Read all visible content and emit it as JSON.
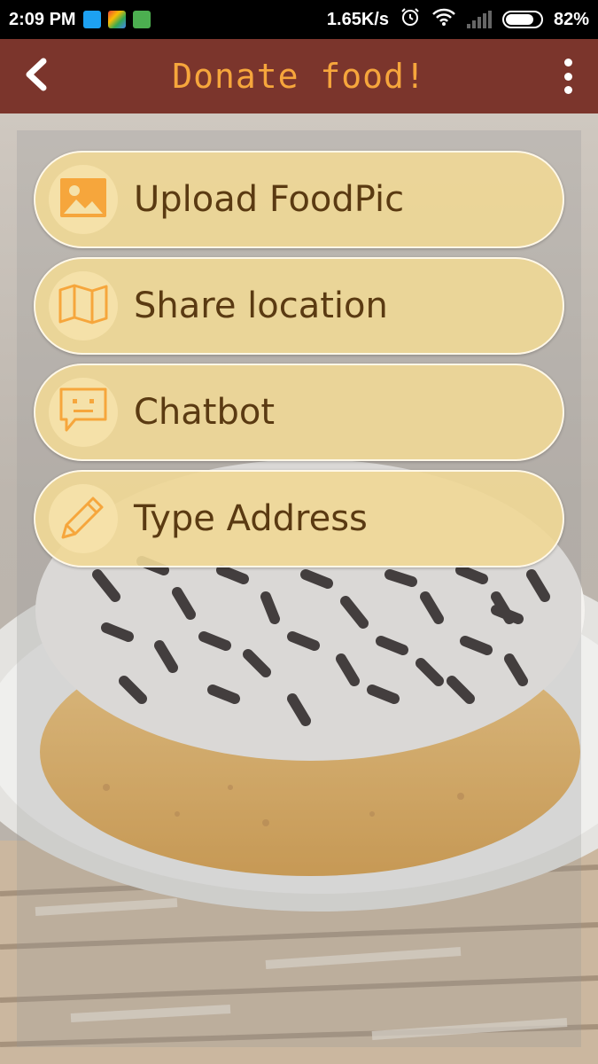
{
  "status_bar": {
    "time": "2:09 PM",
    "speed": "1.65K/s",
    "battery": "82%",
    "battery_level": 0.82,
    "icons": [
      "twitter-icon",
      "google-play-icon",
      "android-bot-icon",
      "alarm-icon",
      "wifi-icon",
      "signal-icon",
      "battery-icon"
    ]
  },
  "app_bar": {
    "title": "Donate food!",
    "back_icon": "chevron-left-icon",
    "menu_icon": "more-vertical-icon"
  },
  "actions": [
    {
      "label": "Upload FoodPic",
      "icon": "image-icon"
    },
    {
      "label": "Share location",
      "icon": "map-icon"
    },
    {
      "label": "Chatbot",
      "icon": "chat-icon"
    },
    {
      "label": "Type Address",
      "icon": "pencil-icon"
    }
  ],
  "colors": {
    "app_bar": "#7b352c",
    "title": "#f6a63c",
    "button_fill": "#f0d896",
    "button_text": "#5a3a12",
    "icon": "#f6a63c"
  }
}
